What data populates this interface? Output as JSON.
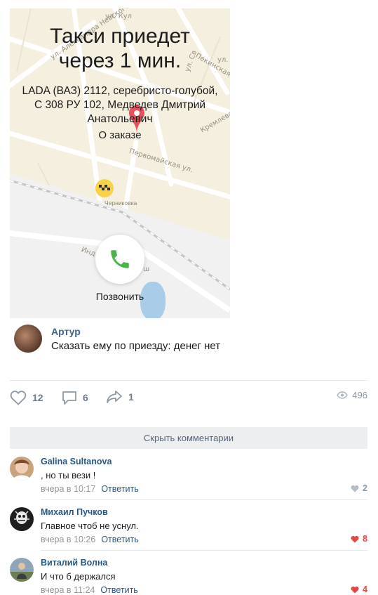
{
  "map_screen": {
    "title_line1": "Такси приедет",
    "title_line2": "через 1 мин.",
    "car_info": "LADA (ВАЗ) 2112, серебристо-голубой, С 308 РУ 102, Медведев Дмитрий Анатольевич",
    "order_link": "О заказе",
    "call_label": "Позвонить",
    "village_label": "Черниковка",
    "streets": [
      "ул. Кул",
      "ул. Александра Невского",
      "ул. Л",
      "ул. Св",
      "Пекинская ул.",
      "Кремлевская ул.",
      "Первомайская ул.",
      "Инд",
      "ш"
    ]
  },
  "post_comment": {
    "author": "Артур",
    "text": "Сказать ему по приезду: денег нет"
  },
  "actions": {
    "likes": "12",
    "comments": "6",
    "shares": "1",
    "views": "496"
  },
  "hide_comments_label": "Скрыть комментарии",
  "comments": [
    {
      "author": "Galina Sultanova",
      "text": ", но ты вези !",
      "time": "вчера в 10:17",
      "reply": "Ответить",
      "likes": "2",
      "liked": false
    },
    {
      "author": "Михаил Пучков",
      "text": "Главное чтоб не уснул.",
      "time": "вчера в 10:26",
      "reply": "Ответить",
      "likes": "8",
      "liked": true
    },
    {
      "author": "Виталий Волна",
      "text": "И что б держался",
      "time": "вчера в 11:24",
      "reply": "Ответить",
      "likes": "4",
      "liked": true
    }
  ],
  "colors": {
    "link": "#2a5885",
    "like_active": "#e64646",
    "like_inactive": "#b8bec5",
    "taxi_yellow": "#f8d34a",
    "call_green": "#4bb34b",
    "pin_red": "#e8505b"
  }
}
